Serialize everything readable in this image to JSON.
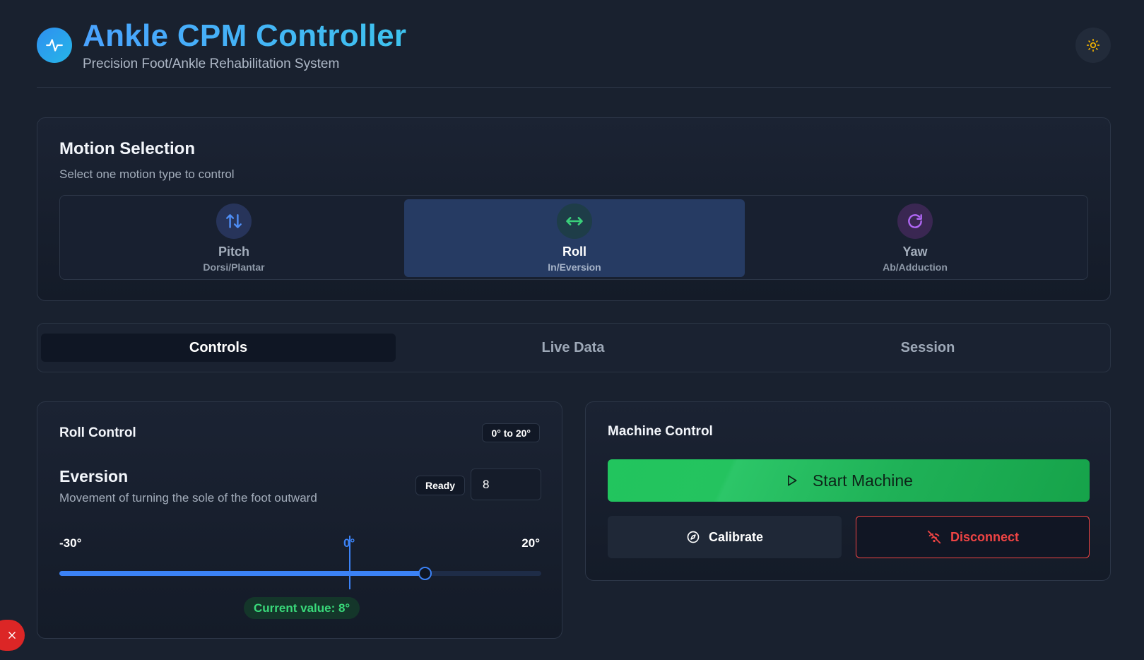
{
  "header": {
    "title": "Ankle CPM Controller",
    "subtitle": "Precision Foot/Ankle Rehabilitation System",
    "logo_icon": "activity-pulse-icon",
    "theme_icon": "sun-icon"
  },
  "motion": {
    "title": "Motion Selection",
    "subtitle": "Select one motion type to control",
    "selected": "Roll",
    "options": [
      {
        "label": "Pitch",
        "desc": "Dorsi/Plantar",
        "icon": "arrows-up-down-icon",
        "color": "#3b82f6"
      },
      {
        "label": "Roll",
        "desc": "In/Eversion",
        "icon": "arrows-left-right-icon",
        "color": "#22c55e"
      },
      {
        "label": "Yaw",
        "desc": "Ab/Adduction",
        "icon": "rotate-cw-icon",
        "color": "#a855f7"
      }
    ]
  },
  "tabs": {
    "active": "Controls",
    "items": [
      {
        "label": "Controls"
      },
      {
        "label": "Live Data"
      },
      {
        "label": "Session"
      }
    ]
  },
  "roll_control": {
    "title": "Roll Control",
    "range_badge": "0° to 20°",
    "motion_name": "Eversion",
    "description": "Movement of turning the sole of the foot outward",
    "status_badge": "Ready",
    "input_value": "8",
    "slider": {
      "min": -30,
      "max": 20,
      "value": 8,
      "min_label": "-30°",
      "zero_label": "0°",
      "max_label": "20°"
    },
    "current_value_text": "Current value: 8°"
  },
  "machine_control": {
    "title": "Machine Control",
    "start_label": "Start Machine",
    "calibrate_label": "Calibrate",
    "disconnect_label": "Disconnect"
  },
  "colors": {
    "accent": "#3b82f6",
    "success": "#22c55e",
    "danger": "#ef4444",
    "background": "#19212f"
  }
}
